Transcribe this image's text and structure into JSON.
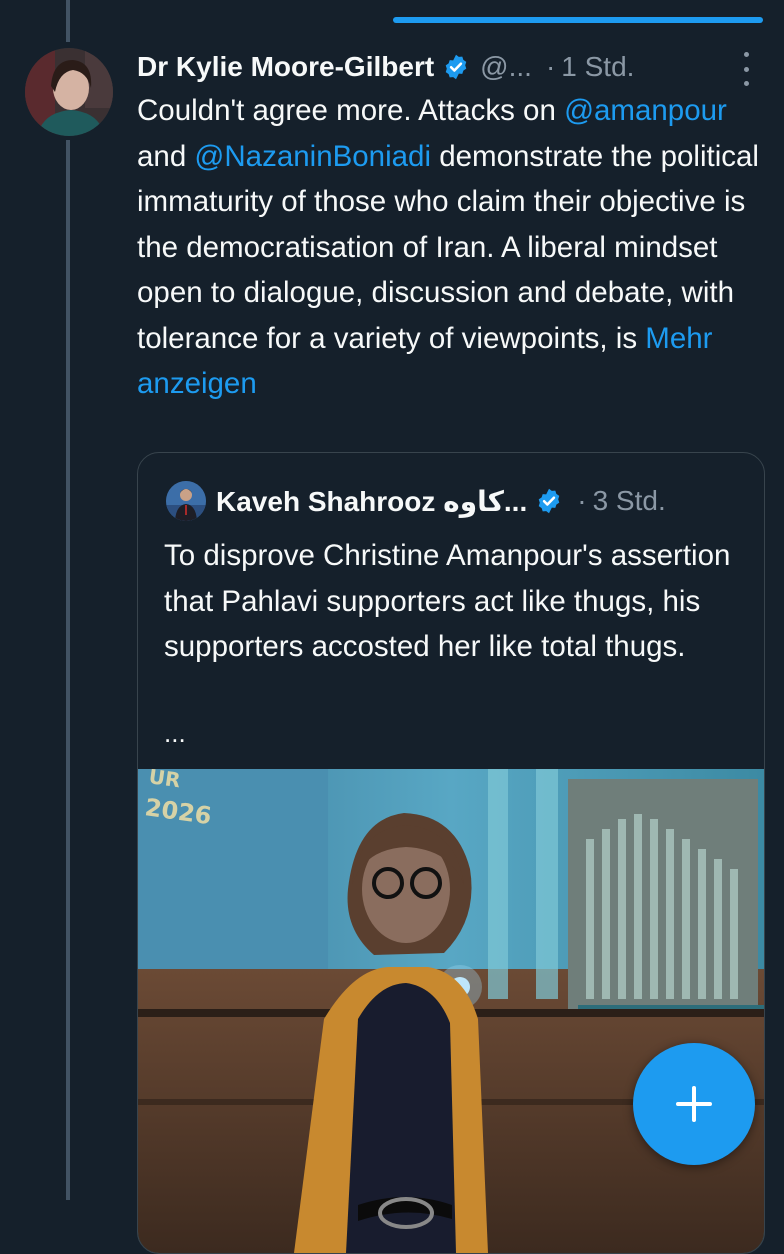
{
  "tweet": {
    "author_name": "Dr Kylie Moore-Gilbert",
    "handle": "@...",
    "separator": "·",
    "time": "1 Std.",
    "text_1": "Couldn't agree more. Attacks on ",
    "mention_1": "@amanpour",
    "text_2": " and ",
    "mention_2": "@NazaninBoniadi",
    "text_3": " demonstrate the political immaturity of those who claim their objective is the democratisation of Iran. A liberal mindset open to dialogue, discussion and debate, with tolerance for a variety of viewpoints, is ",
    "show_more": "Mehr anzeigen"
  },
  "quote": {
    "author_name": "Kaveh Shahrooz کاوه...",
    "separator": "·",
    "time": "3 Std.",
    "text": "To disprove Christine Amanpour's assertion that Pahlavi supporters act like thugs, his supporters accosted her like total thugs.",
    "ellipsis": "...",
    "media_overlay_text_1": "UR",
    "media_overlay_text_2": "2026"
  },
  "colors": {
    "background": "#15202b",
    "accent": "#1d9bf0",
    "text_primary": "#f7f9f9",
    "text_secondary": "#8b98a5",
    "border": "#38444d"
  },
  "icons": {
    "verified": "verified-badge-icon",
    "more": "more-vertical-icon",
    "compose": "plus-icon"
  }
}
